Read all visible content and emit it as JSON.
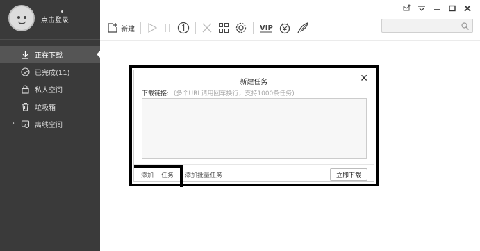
{
  "user": {
    "login_label": "点击登录"
  },
  "sidebar": {
    "items": [
      {
        "label": "正在下载",
        "icon": "download-icon",
        "active": true
      },
      {
        "label": "已完成(11)",
        "icon": "check-circle-icon",
        "active": false
      },
      {
        "label": "私人空间",
        "icon": "lock-icon",
        "active": false
      },
      {
        "label": "垃圾箱",
        "icon": "trash-icon",
        "active": false
      },
      {
        "label": "离线空间",
        "icon": "cloud-icon",
        "active": false
      }
    ]
  },
  "toolbar": {
    "new_label": "新建",
    "buttons": [
      "new-task-icon",
      "play-icon",
      "pause-icon",
      "speed-icon",
      "delete-icon",
      "apps-icon",
      "settings-icon",
      "vip-icon",
      "shop-icon",
      "wing-icon"
    ]
  },
  "search": {
    "placeholder": ""
  },
  "dialog": {
    "title": "新建任务",
    "link_label": "下载链接:",
    "hint": "(多个URL请用回车换行，支持1000条任务)",
    "textarea_value": "",
    "add_label": "添加",
    "task_label": "任务",
    "batch_label": "添加批量任务",
    "download_button": "立即下载"
  },
  "colors": {
    "sidebar_bg": "#3a3a3a",
    "sidebar_active": "#555555",
    "highlight_border": "#000000"
  }
}
